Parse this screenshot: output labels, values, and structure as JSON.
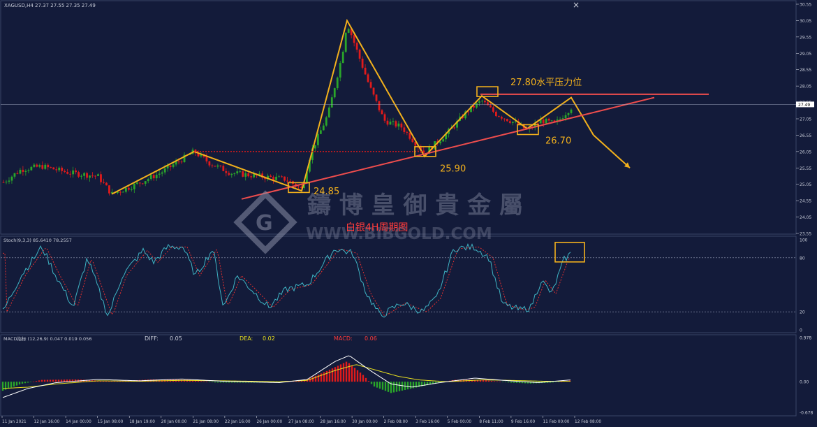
{
  "colors": {
    "background": "#131b3a",
    "grid": "#3a4466",
    "text": "#c8ccd8",
    "bull": "#2aa62a",
    "bear": "#e01b1b",
    "annotation": "#f3b11c",
    "trendline": "#ef4d4d",
    "stoch_main": "#3fb4c4",
    "stoch_signal": "#e03030",
    "macd_fast": "#ffffff",
    "macd_slow": "#e8e020",
    "label_red": "#ff3b3b"
  },
  "header": {
    "symbol_line": "XAGUSD,H4  27.37 27.55 27.35 27.49"
  },
  "window_controls": {
    "close_icon": "×"
  },
  "watermark": {
    "cn": "鑄 博 皇 御 貴 金 屬",
    "en": "WWW.BIBGOLD.COM"
  },
  "chart_data": [
    {
      "type": "candlestick",
      "title": "白银4H周期图",
      "symbol": "XAGUSD,H4",
      "ohlc_header": {
        "open": 27.37,
        "high": 27.55,
        "low": 27.35,
        "close": 27.49
      },
      "current_price_label": "27.49",
      "ylim": [
        23.55,
        30.55
      ],
      "yticks": [
        "30.55",
        "30.05",
        "29.55",
        "29.05",
        "28.55",
        "28.05",
        "27.55",
        "27.05",
        "26.55",
        "26.05",
        "25.55",
        "25.05",
        "24.55",
        "24.05",
        "23.55"
      ],
      "ytick_values": [
        30.55,
        30.05,
        29.55,
        29.05,
        28.55,
        28.05,
        27.55,
        27.05,
        26.55,
        26.05,
        25.55,
        25.05,
        24.55,
        24.05,
        23.55
      ],
      "current_price": 27.49,
      "key_levels": [
        {
          "label": "24.85",
          "value": 24.85
        },
        {
          "label": "25.90",
          "value": 25.9
        },
        {
          "label": "26.70",
          "value": 26.7
        },
        {
          "label": "27.80水平压力位",
          "value": 27.8
        }
      ]
    },
    {
      "type": "line",
      "title": "Stoch(9,3,3) 85.6410 78.2557",
      "ylim": [
        0,
        100
      ],
      "yticks": [
        "100",
        "80",
        "20",
        "0"
      ],
      "ytick_values": [
        100,
        80,
        20,
        0
      ],
      "levels": [
        80,
        20
      ]
    },
    {
      "type": "bar",
      "title": "MACD指标 (12,26,9) 0.047 0.019 0.056",
      "ylim": [
        -0.678,
        0.978
      ],
      "yticks": [
        "0.978",
        "0.00",
        "-0.678"
      ],
      "ytick_values": [
        0.978,
        0.0,
        -0.678
      ],
      "readouts": [
        {
          "label": "DIFF:",
          "value": "0.05"
        },
        {
          "label": "DEA:",
          "value": "0.02"
        },
        {
          "label": "MACD:",
          "value": "0.06"
        }
      ]
    }
  ],
  "x_axis": {
    "labels": [
      "11 Jan 2021",
      "12 Jan 16:00",
      "14 Jan 00:00",
      "15 Jan 08:00",
      "18 Jan 19:00",
      "20 Jan 00:00",
      "21 Jan 08:00",
      "22 Jan 16:00",
      "26 Jan 00:00",
      "27 Jan 08:00",
      "28 Jan 16:00",
      "30 Jan 00:00",
      "2 Feb 08:00",
      "3 Feb 16:00",
      "5 Feb 00:00",
      "8 Feb 11:00",
      "9 Feb 16:00",
      "11 Feb 00:00",
      "12 Feb 08:00"
    ]
  }
}
